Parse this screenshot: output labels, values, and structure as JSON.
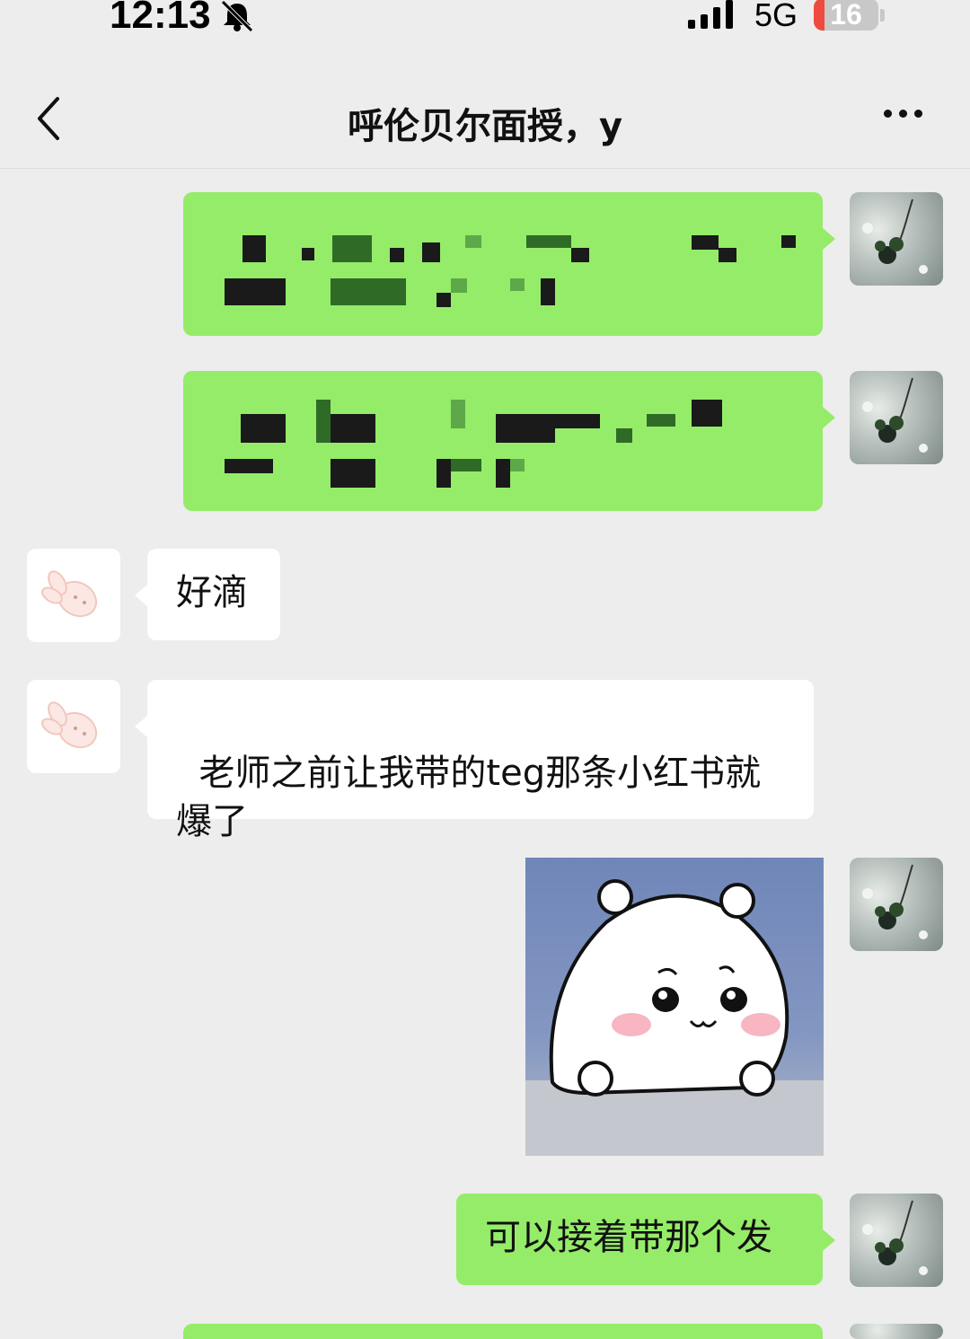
{
  "status_bar": {
    "time": "12:13",
    "network": "5G",
    "battery": "16",
    "battery_level": 0.16
  },
  "header": {
    "title": "呼伦贝尔面授，y"
  },
  "icons": [
    "back-arrow-icon",
    "more-icon",
    "bell-muted-icon",
    "signal-icon",
    "battery-icon"
  ],
  "messages": [
    {
      "side": "right",
      "type": "text",
      "text": ""
    },
    {
      "side": "right",
      "type": "text",
      "text": ""
    },
    {
      "side": "left",
      "type": "text",
      "text": "好滴"
    },
    {
      "side": "left",
      "type": "text",
      "text": "老师之前让我带的teg那条小红书就\n爆了"
    },
    {
      "side": "right",
      "type": "sticker",
      "text": ""
    },
    {
      "side": "right",
      "type": "text",
      "text": "可以接着带那个发"
    }
  ],
  "colors": {
    "bubble_self": "#95ec69",
    "bubble_other": "#ffffff",
    "background": "#ededed"
  }
}
